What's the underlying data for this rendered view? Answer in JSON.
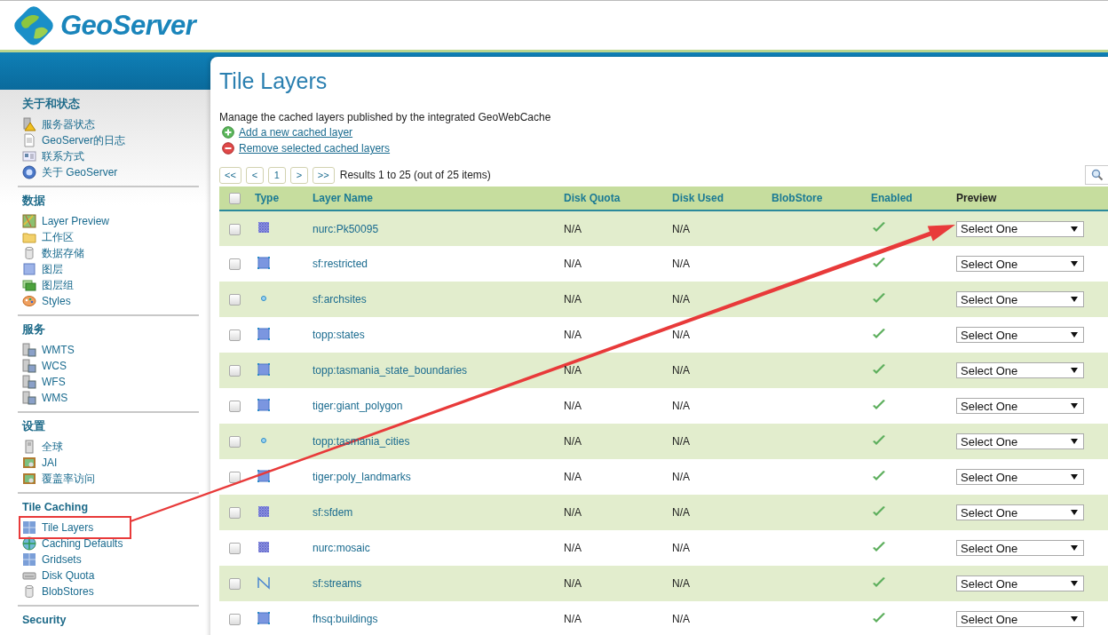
{
  "logo": {
    "text": "GeoServer"
  },
  "sidebar": {
    "sections": [
      {
        "title": "关于和状态",
        "items": [
          {
            "label": "服务器状态",
            "kind": "server-warning",
            "selected": false
          },
          {
            "label": "GeoServer的日志",
            "kind": "document",
            "selected": false
          },
          {
            "label": "联系方式",
            "kind": "card",
            "selected": false
          },
          {
            "label": "关于 GeoServer",
            "kind": "help",
            "selected": false
          }
        ]
      },
      {
        "title": "数据",
        "items": [
          {
            "label": "Layer Preview",
            "kind": "map",
            "selected": false
          },
          {
            "label": "工作区",
            "kind": "folder",
            "selected": false
          },
          {
            "label": "数据存储",
            "kind": "database",
            "selected": false
          },
          {
            "label": "图层",
            "kind": "layer",
            "selected": false
          },
          {
            "label": "图层组",
            "kind": "layer-group",
            "selected": false
          },
          {
            "label": "Styles",
            "kind": "palette",
            "selected": false
          }
        ]
      },
      {
        "title": "服务",
        "items": [
          {
            "label": "WMTS",
            "kind": "service",
            "selected": false
          },
          {
            "label": "WCS",
            "kind": "service",
            "selected": false
          },
          {
            "label": "WFS",
            "kind": "service",
            "selected": false
          },
          {
            "label": "WMS",
            "kind": "service",
            "selected": false
          }
        ]
      },
      {
        "title": "设置",
        "items": [
          {
            "label": "全球",
            "kind": "server",
            "selected": false
          },
          {
            "label": "JAI",
            "kind": "picture-frame",
            "selected": false
          },
          {
            "label": "覆盖率访问",
            "kind": "picture-frame",
            "selected": false
          }
        ]
      },
      {
        "title": "Tile Caching",
        "items": [
          {
            "label": "Tile Layers",
            "kind": "grid",
            "selected": true
          },
          {
            "label": "Caching Defaults",
            "kind": "globe",
            "selected": false
          },
          {
            "label": "Gridsets",
            "kind": "grid",
            "selected": false
          },
          {
            "label": "Disk Quota",
            "kind": "disk",
            "selected": false
          },
          {
            "label": "BlobStores",
            "kind": "database",
            "selected": false
          }
        ]
      },
      {
        "title": "Security"
      }
    ]
  },
  "page": {
    "title": "Tile Layers",
    "description": "Manage the cached layers published by the integrated GeoWebCache",
    "actions": [
      {
        "label": "Add a new cached layer",
        "kind": "add"
      },
      {
        "label": "Remove selected cached layers",
        "kind": "remove"
      }
    ]
  },
  "pager": {
    "buttons": [
      "<<",
      "<",
      "1",
      ">",
      ">>"
    ],
    "summary": "Results 1 to 25 (out of 25 items)"
  },
  "table": {
    "select_all": {
      "checked": false
    },
    "columns": [
      "Type",
      "Layer Name",
      "Disk Quota",
      "Disk Used",
      "BlobStore",
      "Enabled",
      "Preview"
    ],
    "rows": [
      {
        "kind": "raster",
        "name": "nurc:Pk50095",
        "disk_quota": "N/A",
        "disk_used": "N/A",
        "enabled": true,
        "checked": false,
        "preview": "Select One"
      },
      {
        "kind": "polygon",
        "name": "sf:restricted",
        "disk_quota": "N/A",
        "disk_used": "N/A",
        "enabled": true,
        "checked": false,
        "preview": "Select One"
      },
      {
        "kind": "point",
        "name": "sf:archsites",
        "disk_quota": "N/A",
        "disk_used": "N/A",
        "enabled": true,
        "checked": false,
        "preview": "Select One"
      },
      {
        "kind": "polygon",
        "name": "topp:states",
        "disk_quota": "N/A",
        "disk_used": "N/A",
        "enabled": true,
        "checked": false,
        "preview": "Select One"
      },
      {
        "kind": "polygon",
        "name": "topp:tasmania_state_boundaries",
        "disk_quota": "N/A",
        "disk_used": "N/A",
        "enabled": true,
        "checked": false,
        "preview": "Select One"
      },
      {
        "kind": "polygon",
        "name": "tiger:giant_polygon",
        "disk_quota": "N/A",
        "disk_used": "N/A",
        "enabled": true,
        "checked": false,
        "preview": "Select One"
      },
      {
        "kind": "point",
        "name": "topp:tasmania_cities",
        "disk_quota": "N/A",
        "disk_used": "N/A",
        "enabled": true,
        "checked": false,
        "preview": "Select One"
      },
      {
        "kind": "polygon",
        "name": "tiger:poly_landmarks",
        "disk_quota": "N/A",
        "disk_used": "N/A",
        "enabled": true,
        "checked": false,
        "preview": "Select One"
      },
      {
        "kind": "raster",
        "name": "sf:sfdem",
        "disk_quota": "N/A",
        "disk_used": "N/A",
        "enabled": true,
        "checked": false,
        "preview": "Select One"
      },
      {
        "kind": "raster",
        "name": "nurc:mosaic",
        "disk_quota": "N/A",
        "disk_used": "N/A",
        "enabled": true,
        "checked": false,
        "preview": "Select One"
      },
      {
        "kind": "line",
        "name": "sf:streams",
        "disk_quota": "N/A",
        "disk_used": "N/A",
        "enabled": true,
        "checked": false,
        "preview": "Select One"
      },
      {
        "kind": "polygon",
        "name": "fhsq:buildings",
        "disk_quota": "N/A",
        "disk_used": "N/A",
        "enabled": true,
        "checked": false,
        "preview": "Select One"
      }
    ]
  }
}
